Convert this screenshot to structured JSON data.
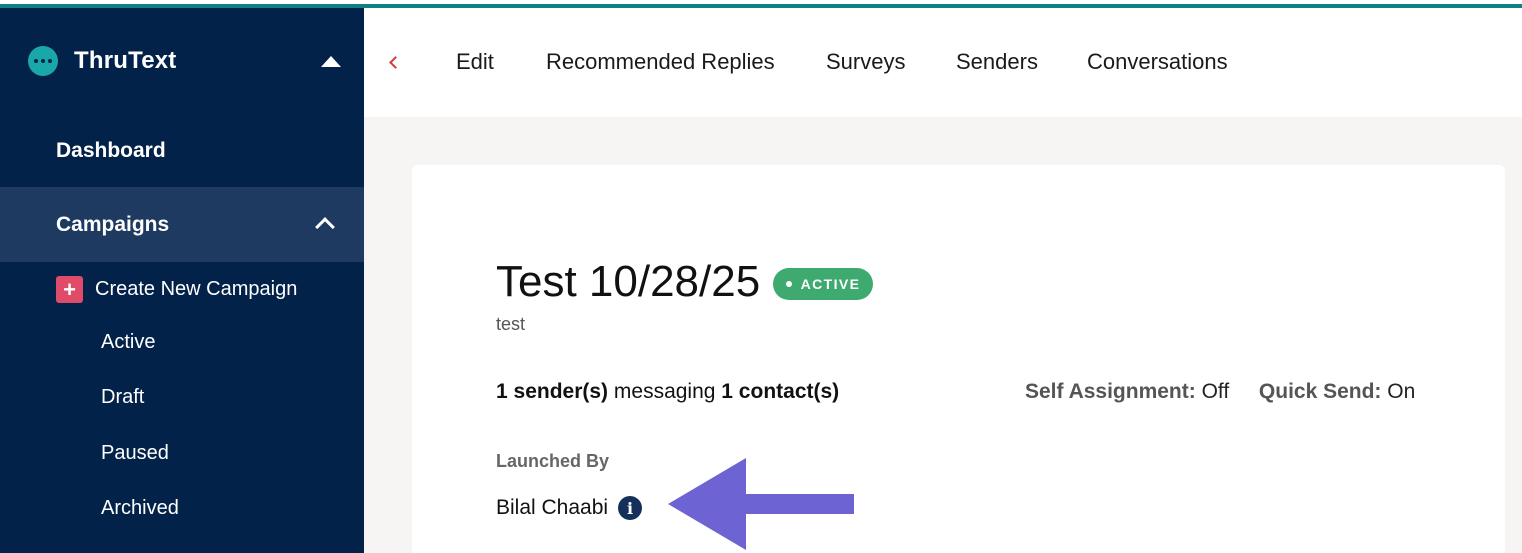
{
  "brand": {
    "name": "ThruText",
    "logo_icon": "thrutext-logo-icon"
  },
  "sidebar": {
    "dashboard": "Dashboard",
    "campaigns": "Campaigns",
    "create_new": "Create New Campaign",
    "sub_items": [
      "Active",
      "Draft",
      "Paused",
      "Archived"
    ]
  },
  "tabs": [
    "Edit",
    "Recommended Replies",
    "Surveys",
    "Senders",
    "Conversations"
  ],
  "campaign": {
    "title": "Test 10/28/25",
    "status": "ACTIVE",
    "description": "test",
    "senders": "1 sender(s)",
    "messaging": "messaging",
    "contacts": "1 contact(s)",
    "self_assignment_label": "Self Assignment:",
    "self_assignment_value": "Off",
    "quick_send_label": "Quick Send:",
    "quick_send_value": "On",
    "launched_by_label": "Launched By",
    "launched_by": "Bilal Chaabi"
  },
  "colors": {
    "sidebar_bg": "#032249",
    "active_nav_bg": "#1e3a60",
    "accent_teal": "#0f7f86",
    "badge_green": "#3faa70",
    "plus_pink": "#e04b6a",
    "arrow_purple": "#6e63d3"
  }
}
